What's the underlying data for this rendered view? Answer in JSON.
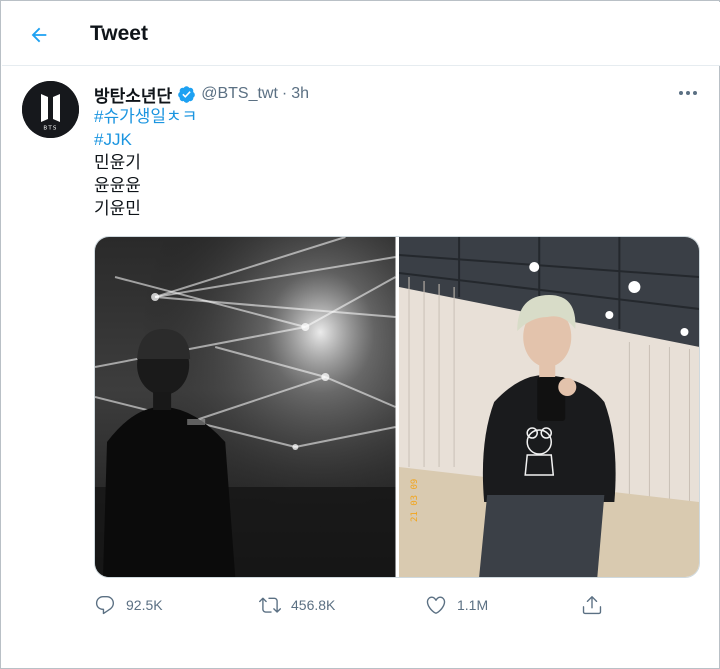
{
  "header": {
    "title": "Tweet",
    "back_icon": "arrow-left-icon"
  },
  "tweet": {
    "author_name": "방탄소년단",
    "verified": true,
    "handle": "@BTS_twt",
    "separator": "·",
    "time": "3h",
    "avatar_logo_text": "BTS",
    "lines": {
      "hashtag1": "#슈가생일ㅊㅋ",
      "hashtag2": "#JJK",
      "line3": "민윤기",
      "line4": "윤윤윤",
      "line5": "기윤민"
    },
    "photo_timestamp": "21 03 09"
  },
  "actions": {
    "reply_count": "92.5K",
    "retweet_count": "456.8K",
    "like_count": "1.1M",
    "share_icon": "share-icon"
  },
  "colors": {
    "accent": "#1da1f2",
    "hashtag": "#1b95e0",
    "secondary_text": "#5b7083",
    "border": "#e6ecf0"
  }
}
